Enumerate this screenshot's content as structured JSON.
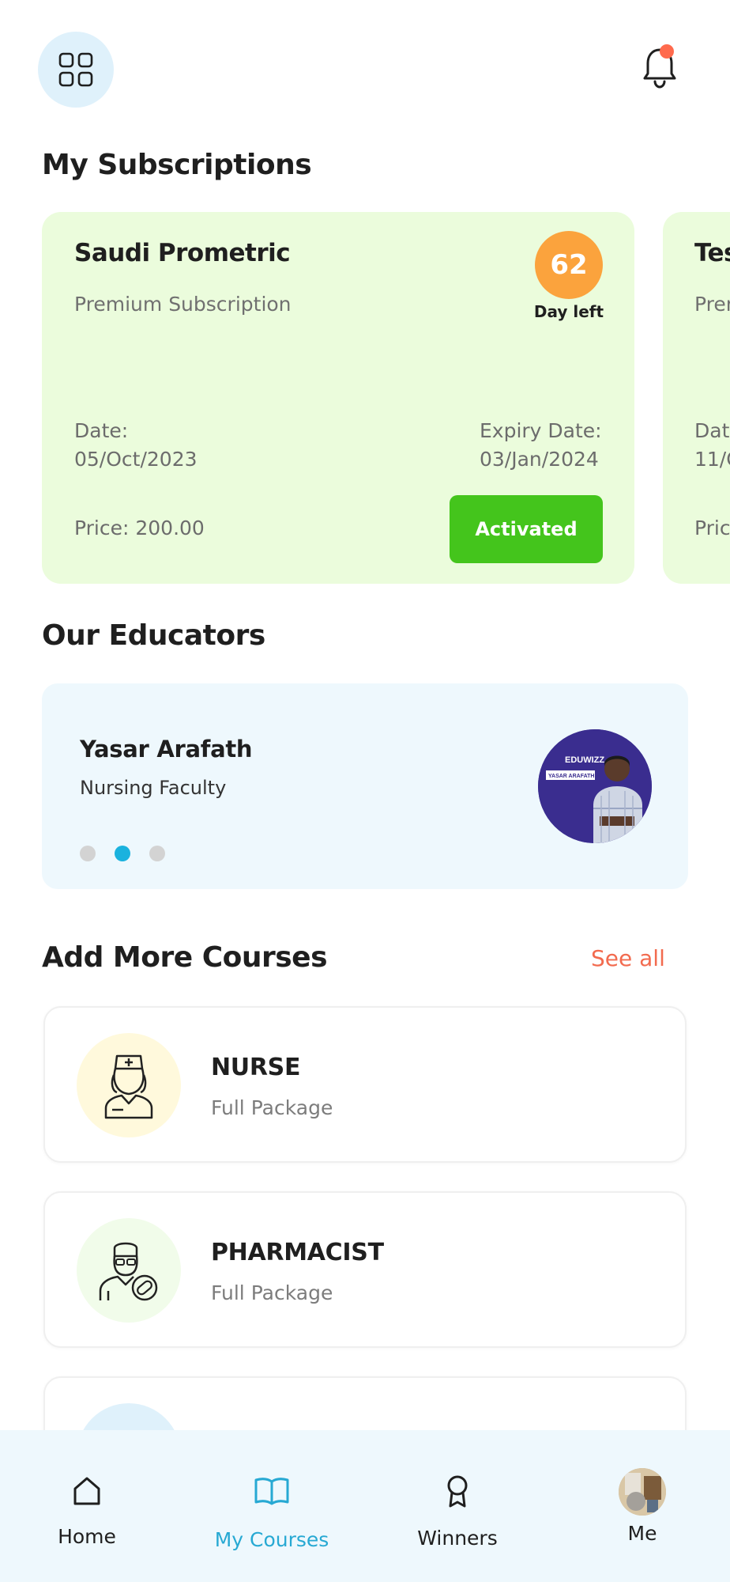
{
  "header": {
    "menu_icon": "grid-icon",
    "notification_icon": "bell-icon",
    "notification_dot_color": "#ff6a4d"
  },
  "subscriptions": {
    "title": "My Subscriptions",
    "cards": [
      {
        "name": "Saudi Prometric",
        "type": "Premium Subscription",
        "days_left": "62",
        "days_label": "Day left",
        "date_label": "Date:",
        "date": "05/Oct/2023",
        "expiry_label": "Expiry Date:",
        "expiry": "03/Jan/2024",
        "price": "Price: 200.00",
        "status": "Activated"
      },
      {
        "name": "Tes",
        "type": "Prem",
        "date_label": "Date",
        "date": "11/O",
        "price": "Pric"
      }
    ]
  },
  "educators": {
    "title": "Our Educators",
    "name": "Yasar Arafath",
    "role": "Nursing Faculty",
    "carousel_active_index": 1,
    "carousel_count": 3,
    "avatar_brand": "EDUWIZZ",
    "avatar_caption": "YASAR ARAFATH"
  },
  "courses": {
    "title": "Add More Courses",
    "see_all": "See all",
    "items": [
      {
        "name": "NURSE",
        "package": "Full Package",
        "icon": "nurse-icon",
        "bg": "#fff9dc"
      },
      {
        "name": "PHARMACIST",
        "package": "Full Package",
        "icon": "pharmacist-icon",
        "bg": "#f1fcea"
      }
    ]
  },
  "nav": {
    "items": [
      {
        "label": "Home",
        "icon": "home-icon"
      },
      {
        "label": "My Courses",
        "icon": "book-icon"
      },
      {
        "label": "Winners",
        "icon": "award-icon"
      },
      {
        "label": "Me",
        "icon": "profile-avatar"
      }
    ],
    "active_index": 1,
    "active_color": "#27a9d3"
  },
  "colors": {
    "subscription_card": "#ebfcdc",
    "days_badge": "#fba33d",
    "activated": "#44c51c",
    "educator_card": "#eef8fd",
    "accent": "#1ab2de",
    "see_all": "#f26b4f"
  }
}
